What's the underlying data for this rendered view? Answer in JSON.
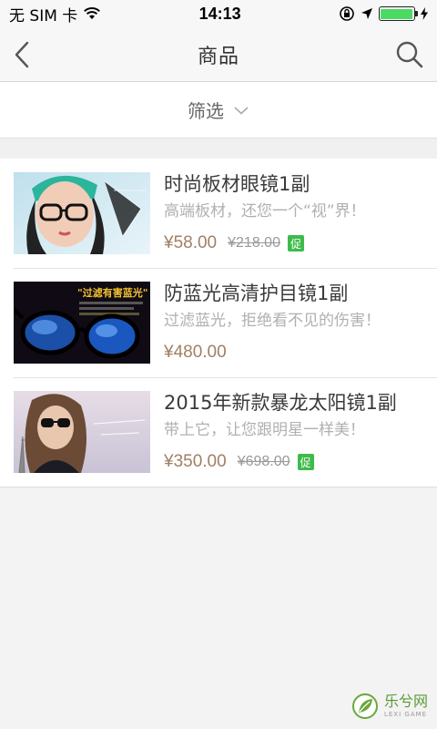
{
  "status_bar": {
    "carrier": "无 SIM 卡",
    "time": "14:13",
    "battery_level": 1.0
  },
  "nav": {
    "title": "商品",
    "back_icon": "chevron-left-icon",
    "search_icon": "search-icon"
  },
  "filter": {
    "label": "筛选",
    "icon": "chevron-down-icon"
  },
  "products": [
    {
      "title": "时尚板材眼镜1副",
      "subtitle": "高端板材，还您一个“视”界！",
      "price": "¥58.00",
      "old_price": "¥218.00",
      "promo": "促"
    },
    {
      "title": "防蓝光高清护目镜1副",
      "subtitle": "过滤蓝光，拒绝看不见的伤害！",
      "price": "¥480.00",
      "old_price": "",
      "promo": "",
      "image_text": "\"过滤有害蓝光\""
    },
    {
      "title": "2015年新款暴龙太阳镜1副",
      "subtitle": "带上它，让您跟明星一样美！",
      "price": "¥350.00",
      "old_price": "¥698.00",
      "promo": "促"
    }
  ],
  "watermark": {
    "main": "乐兮网",
    "sub": "LEXI GAME"
  },
  "colors": {
    "price": "#a08064",
    "promo": "#3dbb4a",
    "battery": "#4cd964"
  }
}
